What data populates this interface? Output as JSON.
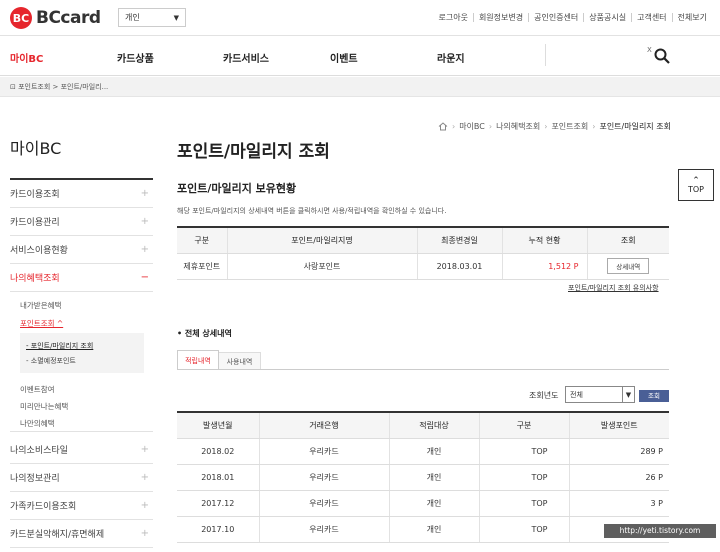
{
  "header": {
    "logo_mark": "BC",
    "logo_text": "BCcard",
    "user_type": "개인",
    "utils": [
      "로그아웃",
      "회원정보변경",
      "공인인증센터",
      "상품공시실",
      "고객센터",
      "전체보기"
    ]
  },
  "gnb": [
    "마이BC",
    "카드상품",
    "카드서비스",
    "이벤트",
    "라운지"
  ],
  "gnb_close": "X",
  "breadcrumb_bar": "⊡ 포인트조회 > 포인트/마일리...",
  "sidebar": {
    "title": "마이BC",
    "items": [
      {
        "label": "카드이용조회"
      },
      {
        "label": "카드이용관리"
      },
      {
        "label": "서비스이용현황"
      },
      {
        "label": "나의혜택조회"
      },
      {
        "label": "나의소비스타일"
      },
      {
        "label": "나의정보관리"
      },
      {
        "label": "가족카드이용조회"
      },
      {
        "label": "카드분실악해지/휴면해제"
      }
    ],
    "sub": [
      "내가받은혜택",
      "포인트조회 ^",
      "이벤트참여",
      "미리만나는혜택",
      "나만의혜택"
    ],
    "sub2": [
      "- 포인트/마일리지 조회",
      "- 소멸예정포인트"
    ]
  },
  "crumb": [
    "마이BC",
    "나의혜택조회",
    "포인트조회",
    "포인트/마일리지 조회"
  ],
  "page_title": "포인트/마일리지 조회",
  "top_button": "TOP",
  "section_title": "포인트/마일리지 보유현황",
  "description": "해당 포인트/마일리지의 상세내역 버튼을 클릭하시면 사용/적립내역을 확인하실 수 있습니다.",
  "holdings": {
    "headers": [
      "구분",
      "포인트/마일리지명",
      "최종변경일",
      "누적 현황",
      "조회"
    ],
    "rows": [
      {
        "type": "제휴포인트",
        "name": "사랑포인트",
        "date": "2018.03.01",
        "total": "1,512 P",
        "btn": "상세내역"
      }
    ]
  },
  "notice_link": "포인트/마일리지 조회 유의사항",
  "detail_title": "전체 상세내역",
  "tabs": [
    "적립내역",
    "사용내역"
  ],
  "filter": {
    "label": "조회년도",
    "select": "전체",
    "button": "조회"
  },
  "details": {
    "headers": [
      "발생년월",
      "거래은행",
      "적립대상",
      "구분",
      "발생포인트"
    ],
    "rows": [
      {
        "ym": "2018.02",
        "bank": "우리카드",
        "target": "개인",
        "kind": "TOP",
        "pts": "289 P"
      },
      {
        "ym": "2018.01",
        "bank": "우리카드",
        "target": "개인",
        "kind": "TOP",
        "pts": "26 P"
      },
      {
        "ym": "2017.12",
        "bank": "우리카드",
        "target": "개인",
        "kind": "TOP",
        "pts": "3 P"
      },
      {
        "ym": "2017.10",
        "bank": "우리카드",
        "target": "개인",
        "kind": "TOP",
        "pts": ""
      }
    ]
  },
  "watermark": "http://yeti.tistory.com"
}
